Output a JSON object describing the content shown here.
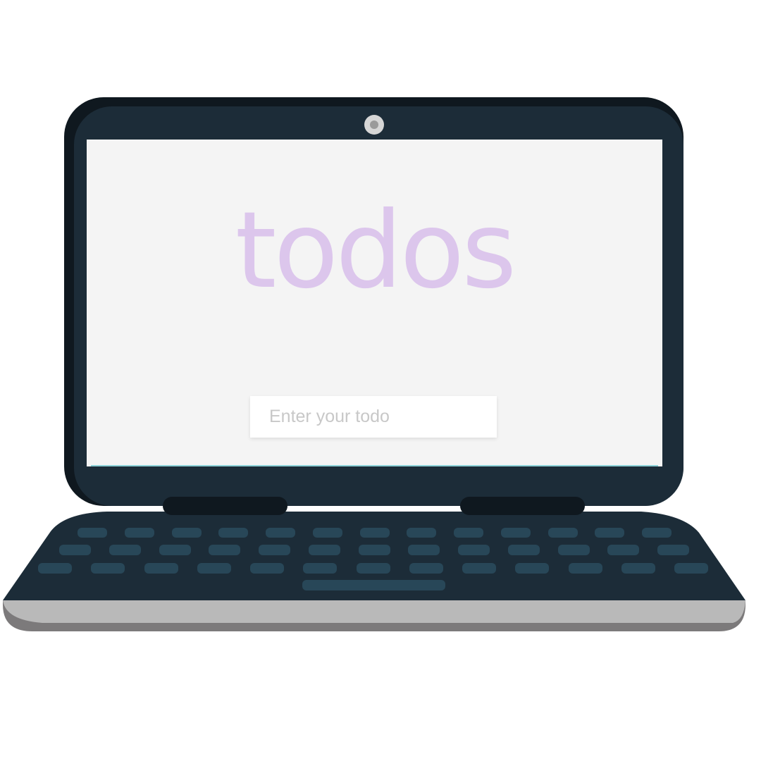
{
  "app": {
    "title": "todos"
  },
  "todo_input": {
    "placeholder": "Enter your todo",
    "value": ""
  },
  "colors": {
    "title": "#dcc6ec",
    "screen_background": "#f4f4f4",
    "laptop_body": "#1c2c38",
    "keys": "#284758",
    "base_edge": "#b9b9b9"
  },
  "icons": {
    "webcam": "webcam-icon"
  }
}
